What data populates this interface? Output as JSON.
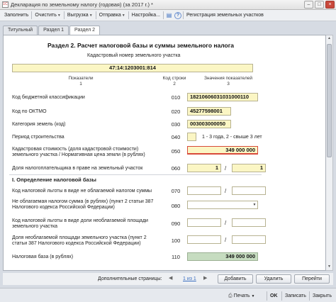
{
  "window": {
    "title": "Декларация по земельному налогу (годовая) (за 2017 г.) *",
    "app_icon": "1С",
    "minimize_icon": "minimize-icon",
    "maximize_icon": "maximize-icon",
    "close_icon": "close-icon"
  },
  "toolbar": {
    "fill": "Заполнить",
    "clear": "Очистить",
    "export": "Выгрузка",
    "send": "Отправка",
    "settings": "Настройка...",
    "registry": "Регистрация земельных участков"
  },
  "tabs": [
    {
      "label": "Титульный"
    },
    {
      "label": "Раздел 1"
    },
    {
      "label": "Раздел 2"
    }
  ],
  "form": {
    "title": "Раздел 2. Расчет налоговой базы и суммы земельного налога",
    "cadastral_label": "Кадастровый номер земельного участка",
    "cadastral_value": "47:14:1203001:814",
    "col_indicators": "Показатели",
    "col_indicators_num": "1",
    "col_code": "Код строки",
    "col_code_num": "2",
    "col_values": "Значения показателей",
    "col_values_num": "3",
    "rows": {
      "kbk": {
        "label": "Код бюджетной классификации",
        "code": "010",
        "value": "18210606031031000110"
      },
      "oktmo": {
        "label": "Код по ОКТМО",
        "code": "020",
        "value": "45277598001"
      },
      "category": {
        "label": "Категория земель (код)",
        "code": "030",
        "value": "003003000050"
      },
      "period": {
        "label": "Период строительства",
        "code": "040",
        "value": "",
        "hint": "1 - 3 года, 2 - свыше 3 лет"
      },
      "cadastral_cost": {
        "label": "Кадастровая стоимость (доля кадастровой стоимости) земельного участка / Нормативная цена земли (в рублях)",
        "code": "050",
        "value": "349 000 000"
      },
      "share": {
        "label": "Доля налогоплательщика в праве на земельный участок",
        "code": "060",
        "value1": "1",
        "value2": "1"
      },
      "group_title": "I. Определение налоговой базы",
      "exempt_code_code": {
        "label": "Код налоговой льготы в виде не облагаемой налогом суммы",
        "code": "070",
        "value": ""
      },
      "exempt_sum": {
        "label": "Не облагаемая налогом сумма (в рублях) (пункт 2 статьи 387 Налогового кодекса Российской Федерации)",
        "code": "080",
        "value": ""
      },
      "exempt_area_code": {
        "label": "Код налоговой льготы в виде доли необлагаемой площади земельного участка",
        "code": "090",
        "value": ""
      },
      "exempt_area_share": {
        "label": "Доля необлагаемой площади земельного участка (пункт 2 статьи 387 Налогового кодекса Российской Федерации)",
        "code": "100",
        "value": ""
      },
      "tax_base": {
        "label": "Налоговая база (в рублях)",
        "code": "110",
        "value": "349 000 000"
      }
    }
  },
  "pager": {
    "label": "Дополнительные страницы:",
    "page": "1 из 1",
    "add": "Добавить",
    "delete": "Удалить",
    "goto": "Перейти"
  },
  "status": {
    "print": "Печать",
    "ok": "OK",
    "save": "Записать",
    "close": "Закрыть"
  },
  "colors": {
    "field_yellow": "#fbf6c4",
    "field_green": "#c6dcc0",
    "error_red": "#d84a3b"
  }
}
